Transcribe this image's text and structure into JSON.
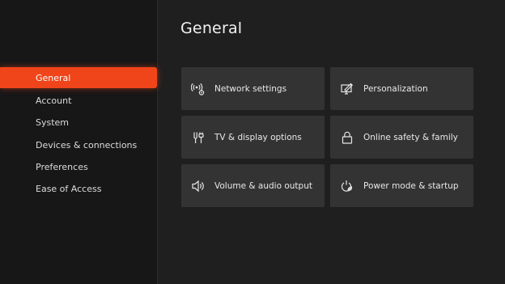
{
  "page": {
    "title": "General"
  },
  "sidebar": {
    "items": [
      {
        "label": "General",
        "active": true
      },
      {
        "label": "Account"
      },
      {
        "label": "System"
      },
      {
        "label": "Devices & connections"
      },
      {
        "label": "Preferences"
      },
      {
        "label": "Ease of Access"
      }
    ]
  },
  "tiles": [
    {
      "label": "Network settings",
      "icon": "network-icon"
    },
    {
      "label": "Personalization",
      "icon": "personalization-icon"
    },
    {
      "label": "TV & display options",
      "icon": "tv-display-icon"
    },
    {
      "label": "Online safety & family",
      "icon": "lock-icon"
    },
    {
      "label": "Volume & audio output",
      "icon": "speaker-icon"
    },
    {
      "label": "Power mode & startup",
      "icon": "power-icon"
    }
  ],
  "colors": {
    "accent": "#f0441a",
    "tile": "#333333",
    "background": "#1f1f1f",
    "sidebar": "#171717"
  }
}
